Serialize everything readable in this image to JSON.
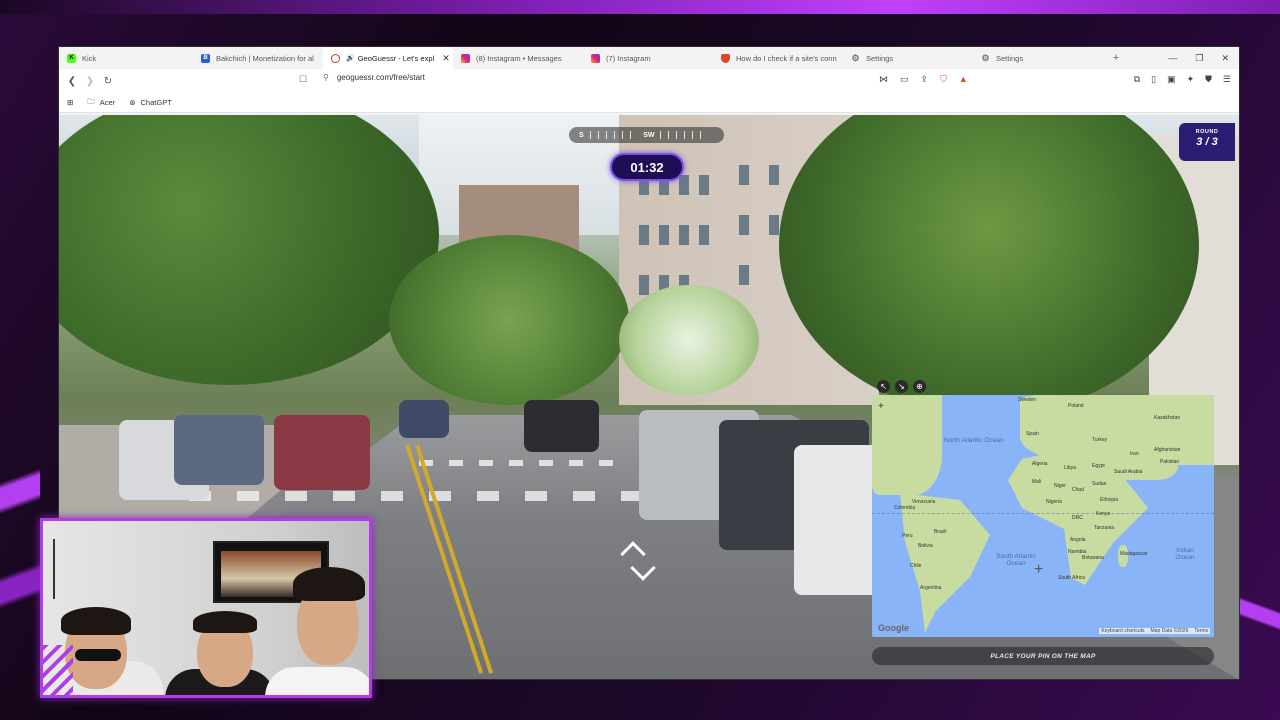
{
  "browser": {
    "tabs": [
      {
        "label": "Kick",
        "icon": "kick-icon",
        "color": "#53fc18",
        "active": false
      },
      {
        "label": "Bakchich | Monetization for al",
        "icon": "bakchich-icon",
        "color": "#2b5fd9",
        "active": false
      },
      {
        "label": "GeoGuessr - Let's expl",
        "icon": "geoguessr-icon",
        "color": "#c0392b",
        "active": true
      },
      {
        "label": "(8) Instagram • Messages",
        "icon": "instagram-icon",
        "color": "#d62976",
        "active": false
      },
      {
        "label": "(7) Instagram",
        "icon": "instagram-icon",
        "color": "#d62976",
        "active": false
      },
      {
        "label": "How do I check if a site's conn",
        "icon": "brave-icon",
        "color": "#e0462b",
        "active": false
      },
      {
        "label": "Settings",
        "icon": "gear-icon",
        "color": "#777777",
        "active": false
      },
      {
        "label": "Settings",
        "icon": "gear-icon",
        "color": "#777777",
        "active": false
      }
    ],
    "url": "geoguessr.com/free/start",
    "bookmarks": [
      {
        "label": "Acer",
        "icon": "folder-icon"
      },
      {
        "label": "ChatGPT",
        "icon": "chatgpt-icon"
      }
    ]
  },
  "game": {
    "compass": {
      "left": "S",
      "center": "SW"
    },
    "timer": "01:32",
    "round": {
      "label": "ROUND",
      "value": "3 / 3"
    },
    "map": {
      "labels": {
        "north_atlantic": "North Atlantic Ocean",
        "south_atlantic": "South Atlantic Ocean",
        "indian": "Indian Ocean"
      },
      "countries": [
        {
          "name": "Sweden"
        },
        {
          "name": "Poland"
        },
        {
          "name": "Kazakhstan"
        },
        {
          "name": "Spain"
        },
        {
          "name": "Turkey"
        },
        {
          "name": "Afghanistan"
        },
        {
          "name": "Iran"
        },
        {
          "name": "Pakistan"
        },
        {
          "name": "Algeria"
        },
        {
          "name": "Libya"
        },
        {
          "name": "Egypt"
        },
        {
          "name": "Saudi Arabia"
        },
        {
          "name": "Mali"
        },
        {
          "name": "Niger"
        },
        {
          "name": "Chad"
        },
        {
          "name": "Sudan"
        },
        {
          "name": "Ethiopia"
        },
        {
          "name": "Nigeria"
        },
        {
          "name": "Venezuela"
        },
        {
          "name": "Colombia"
        },
        {
          "name": "DRC"
        },
        {
          "name": "Kenya"
        },
        {
          "name": "Tanzania"
        },
        {
          "name": "Brazil"
        },
        {
          "name": "Peru"
        },
        {
          "name": "Bolivia"
        },
        {
          "name": "Angola"
        },
        {
          "name": "Namibia"
        },
        {
          "name": "Botswana"
        },
        {
          "name": "Madagascar"
        },
        {
          "name": "Chile"
        },
        {
          "name": "Argentina"
        },
        {
          "name": "South Africa"
        }
      ],
      "google_logo": "Google",
      "attribution": [
        "Keyboard shortcuts",
        "Map Data ©2026",
        "Terms"
      ]
    },
    "place_pin": "PLACE YOUR PIN ON THE MAP"
  },
  "colors": {
    "accent": "#7d52e6",
    "overlay": "#b03ee8",
    "map_water": "#8ab4f8",
    "map_land": "#c8dba0"
  }
}
